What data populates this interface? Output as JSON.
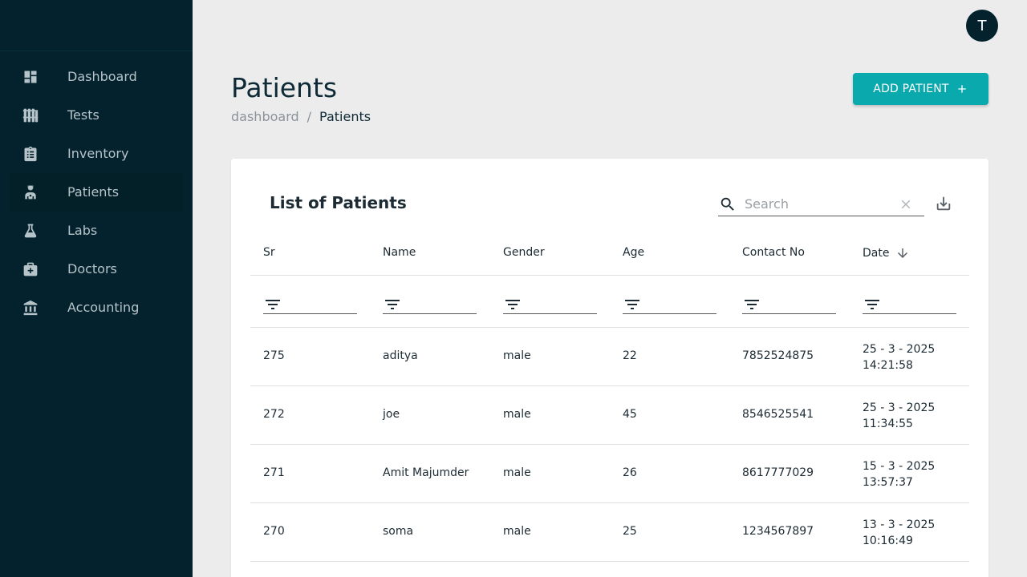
{
  "sidebar": {
    "items": [
      {
        "label": "Dashboard",
        "icon": "dashboard-icon"
      },
      {
        "label": "Tests",
        "icon": "test-tubes-icon"
      },
      {
        "label": "Inventory",
        "icon": "clipboard-icon"
      },
      {
        "label": "Patients",
        "icon": "patient-icon",
        "active": true
      },
      {
        "label": "Labs",
        "icon": "flask-icon"
      },
      {
        "label": "Doctors",
        "icon": "medical-bag-icon"
      },
      {
        "label": "Accounting",
        "icon": "bank-icon"
      }
    ]
  },
  "header": {
    "avatar_initial": "T"
  },
  "page": {
    "title": "Patients",
    "breadcrumb": {
      "link": "dashboard",
      "separator": "/",
      "current": "Patients"
    },
    "add_button": "ADD PATIENT"
  },
  "card": {
    "title": "List of Patients",
    "search": {
      "placeholder": "Search",
      "value": ""
    }
  },
  "table": {
    "columns": [
      "Sr",
      "Name",
      "Gender",
      "Age",
      "Contact No",
      "Date"
    ],
    "sorted_column": "Date",
    "sort_direction": "descending",
    "rows": [
      {
        "sr": "275",
        "name": "aditya",
        "gender": "male",
        "age": "22",
        "contact": "7852524875",
        "date": "25 - 3 - 2025",
        "time": "14:21:58"
      },
      {
        "sr": "272",
        "name": "joe",
        "gender": "male",
        "age": "45",
        "contact": "8546525541",
        "date": "25 - 3 - 2025",
        "time": "11:34:55"
      },
      {
        "sr": "271",
        "name": "Amit Majumder",
        "gender": "male",
        "age": "26",
        "contact": "8617777029",
        "date": "15 - 3 - 2025",
        "time": "13:57:37"
      },
      {
        "sr": "270",
        "name": "soma",
        "gender": "male",
        "age": "25",
        "contact": "1234567897",
        "date": "13 - 3 - 2025",
        "time": "10:16:49"
      }
    ]
  },
  "colors": {
    "sidebar_bg": "#04222d",
    "accent": "#0aa9ad",
    "page_bg": "#ececec"
  }
}
